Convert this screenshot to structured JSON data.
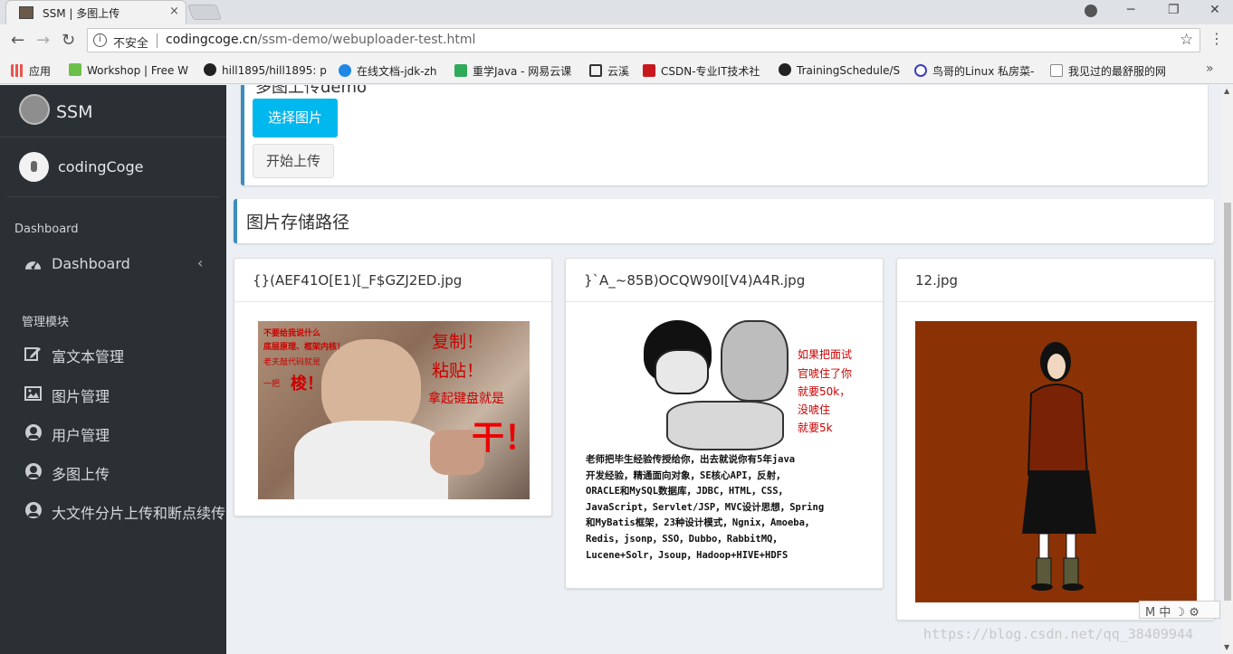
{
  "browser": {
    "tab_title": "SSM | 多图上传",
    "tab_close": "×",
    "window_controls": {
      "minimize": "─",
      "restore": "❐",
      "close": "✕"
    },
    "nav": {
      "back": "←",
      "forward": "→",
      "reload": "↻"
    },
    "security_label": "不安全",
    "url_domain": "codingcoge.cn",
    "url_path": "/ssm-demo/webuploader-test.html",
    "bookmarks": [
      {
        "label": "应用",
        "icon": "apps-icon",
        "color": "#e8554e"
      },
      {
        "label": "Workshop | Free W",
        "icon": "workshop-icon",
        "color": "#6cc04a"
      },
      {
        "label": "hill1895/hill1895: p",
        "icon": "github-icon",
        "color": "#222222"
      },
      {
        "label": "在线文档-jdk-zh",
        "icon": "doc-icon",
        "color": "#1e88e5"
      },
      {
        "label": "重学Java - 网易云课",
        "icon": "netease-icon",
        "color": "#2eaa5a"
      },
      {
        "label": "云溪",
        "icon": "cloud-icon",
        "color": "#333333"
      },
      {
        "label": "CSDN-专业IT技术社",
        "icon": "csdn-icon",
        "color": "#c9171e"
      },
      {
        "label": "TrainingSchedule/S",
        "icon": "github-icon",
        "color": "#222222"
      },
      {
        "label": "鸟哥的Linux 私房菜-",
        "icon": "linux-icon",
        "color": "#3d3db8"
      },
      {
        "label": "我见过的最舒服的网",
        "icon": "page-icon",
        "color": "#888888"
      }
    ],
    "bookmarks_more": "»"
  },
  "sidebar": {
    "brand": "SSM",
    "user_name": "codingCoge",
    "section_dashboard": "Dashboard",
    "dashboard_item": "Dashboard",
    "section_modules": "管理模块",
    "items": [
      {
        "label": "富文本管理",
        "icon": "edit-icon"
      },
      {
        "label": "图片管理",
        "icon": "image-icon"
      },
      {
        "label": "用户管理",
        "icon": "user-icon"
      },
      {
        "label": "多图上传",
        "icon": "user-icon"
      },
      {
        "label": "大文件分片上传和断点续传",
        "icon": "user-icon"
      }
    ]
  },
  "upload": {
    "title": "多图上传demo",
    "pick_button": "选择图片",
    "start_button": "开始上传"
  },
  "gallery": {
    "title": "图片存储路径",
    "cards": [
      {
        "filename": "{}(AEF41O[E1)[_F$GZJ2ED.jpg"
      },
      {
        "filename": "}`A_~85B)OCQW90I[V4)A4R.jpg"
      },
      {
        "filename": "12.jpg"
      }
    ],
    "meme1": {
      "lines": [
        "不要给我说什么",
        "底层原理、框架内核！",
        "老夫敲代码就是",
        "一把",
        "梭！",
        "复制！",
        "粘贴！",
        "拿起键盘就是",
        "干！"
      ]
    },
    "meme2": {
      "caption": [
        "如果把面试",
        "官唬住了你",
        "就要50k，",
        "没唬住",
        "就要5k"
      ],
      "body": [
        "老师把毕生经验传授给你，出去就说你有5年java",
        "开发经验，精通面向对象，SE核心API，反射，",
        "ORACLE和MySQL数据库，JDBC，HTML，CSS，",
        "JavaScript，Servlet/JSP，MVC设计思想，Spring",
        "和MyBatis框架，23种设计模式，Ngnix，Amoeba，",
        "Redis，jsonp，SSO，Dubbo，RabbitMQ，",
        "Lucene+Solr，Jsoup，Hadoop+HIVE+HDFS"
      ]
    }
  },
  "ime_bar": "M 中 ☽ ⚙",
  "watermark": "https://blog.csdn.net/qq_38409944",
  "colors": {
    "sidebar_bg": "#2b3035",
    "accent": "#3c8dbc",
    "pick_button": "#00b7ee",
    "illustration_bg": "#8a3206"
  }
}
